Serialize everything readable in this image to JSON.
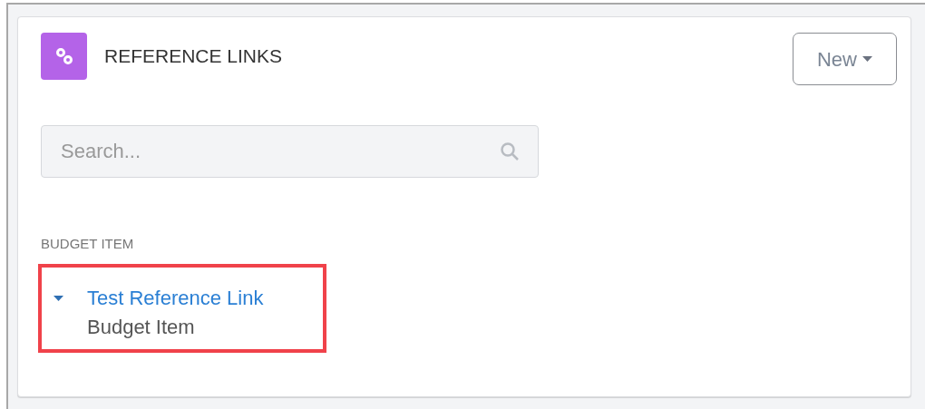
{
  "panel": {
    "title": "REFERENCE LINKS",
    "new_button": "New",
    "search": {
      "placeholder": "Search..."
    },
    "groups": [
      {
        "heading": "BUDGET ITEM",
        "items": [
          {
            "title": "Test Reference Link",
            "subtitle": "Budget Item",
            "expanded": true,
            "highlighted": true
          }
        ]
      }
    ]
  }
}
